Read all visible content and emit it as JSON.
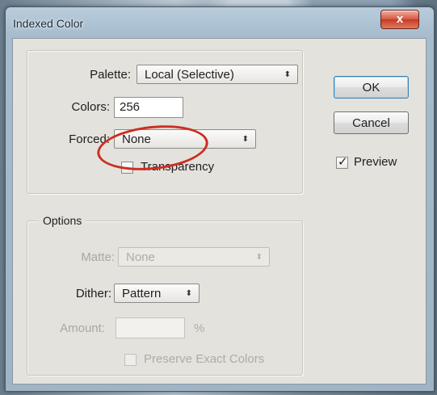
{
  "dialog": {
    "title": "Indexed Color",
    "close_glyph": "x"
  },
  "main_group": {
    "palette_label": "Palette:",
    "palette_value": "Local (Selective)",
    "colors_label": "Colors:",
    "colors_value": "256",
    "forced_label": "Forced:",
    "forced_value": "None",
    "transparency_label": "Transparency",
    "transparency_checked": false
  },
  "options_group": {
    "legend": "Options",
    "matte_label": "Matte:",
    "matte_value": "None",
    "dither_label": "Dither:",
    "dither_value": "Pattern",
    "amount_label": "Amount:",
    "amount_value": "",
    "amount_unit": "%",
    "preserve_label": "Preserve Exact Colors",
    "preserve_checked": false
  },
  "buttons": {
    "ok": "OK",
    "cancel": "Cancel"
  },
  "preview": {
    "label": "Preview",
    "checked": true
  },
  "select_arrow_glyph": "⬍",
  "check_glyph": "✓",
  "colors": {
    "annotation": "#cc2e22",
    "close_button": "#d6563f"
  }
}
